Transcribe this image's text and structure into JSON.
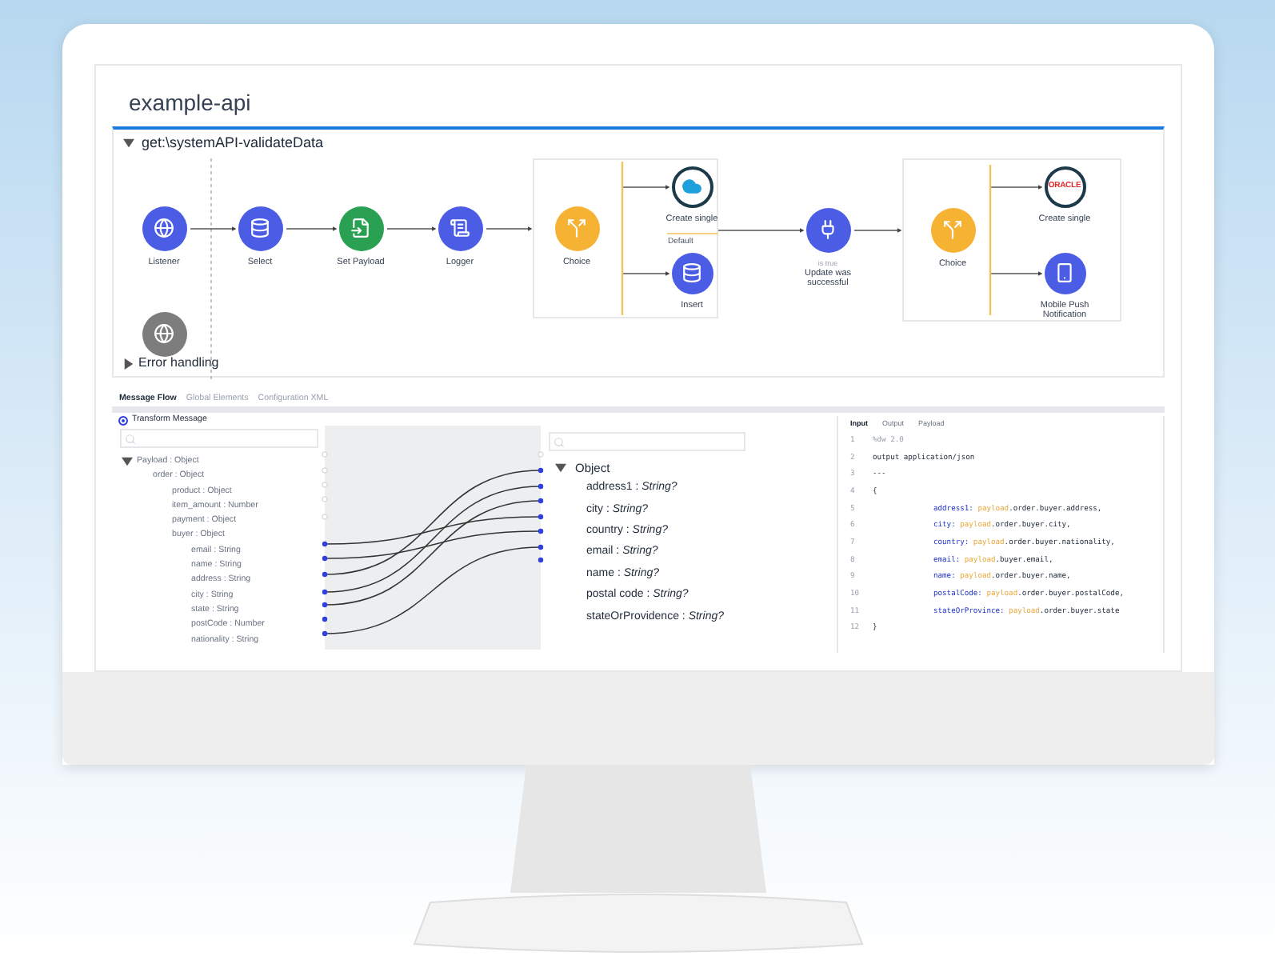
{
  "app_title": "example-api",
  "flow": {
    "title": "get:\\systemAPI-validateData",
    "expanded": true,
    "nodes": [
      {
        "kind": "listener",
        "label": "Listener"
      },
      {
        "kind": "database",
        "label": "Select"
      },
      {
        "kind": "set-payload",
        "label": "Set Payload"
      },
      {
        "kind": "logger",
        "label": "Logger"
      },
      {
        "kind": "choice",
        "label": "Choice"
      },
      {
        "kind": "salesforce",
        "label": "Create single"
      },
      {
        "kind": "database",
        "label": "Insert",
        "branch": "Default"
      },
      {
        "kind": "flow-ref",
        "label": "Update was successful",
        "condition": "is true"
      },
      {
        "kind": "choice",
        "label": "Choice"
      },
      {
        "kind": "oracle",
        "label": "Create single",
        "logo_text": "ORACLE"
      },
      {
        "kind": "push",
        "label": "Mobile Push Notification"
      }
    ],
    "error_handling": {
      "label": "Error handling",
      "expanded": false
    }
  },
  "tabs": [
    {
      "label": "Message Flow",
      "selected": true
    },
    {
      "label": "Global Elements",
      "selected": false
    },
    {
      "label": "Configuration XML",
      "selected": false
    }
  ],
  "transform": {
    "label": "Transform Message",
    "selected": true
  },
  "source_tree": [
    {
      "label": "Payload : Object",
      "expanded": true,
      "children": [
        {
          "label": "order : Object",
          "children": [
            {
              "label": "product : Object"
            },
            {
              "label": "item_amount : Number"
            },
            {
              "label": "payment : Object"
            },
            {
              "label": "buyer : Object",
              "children": [
                {
                  "label": "email : String"
                },
                {
                  "label": "name : String"
                },
                {
                  "label": "address : String"
                },
                {
                  "label": "city : String"
                },
                {
                  "label": "state : String"
                },
                {
                  "label": "postCode : Number"
                },
                {
                  "label": "nationality : String"
                }
              ]
            }
          ]
        }
      ]
    }
  ],
  "target_tree": {
    "label": "Object",
    "expanded": true,
    "fields": [
      "address1 : *String?*",
      "city : *String?*",
      "country : *String?*",
      "email : *String?*",
      "name : *String?*",
      "postal code : *String?*",
      "stateOrProvidence : *String?*"
    ]
  },
  "code_tabs": [
    {
      "label": "Input",
      "selected": true
    },
    {
      "label": "Output",
      "selected": false
    },
    {
      "label": "Payload",
      "selected": false
    }
  ],
  "code_lines": [
    {
      "number": "1",
      "kind": "directive",
      "text": "%dw 2.0"
    },
    {
      "number": "2",
      "kind": "plain",
      "text": "output application/json"
    },
    {
      "number": "3",
      "kind": "plain",
      "text": "---"
    },
    {
      "number": "4",
      "kind": "plain",
      "text": "{"
    },
    {
      "number": "5",
      "kind": "mapping",
      "key": "address1:",
      "source": "payload",
      "path": ".order.buyer.address,"
    },
    {
      "number": "6",
      "kind": "mapping",
      "key": "city:",
      "source": "payload",
      "path": ".order.buyer.city,"
    },
    {
      "number": "7",
      "kind": "mapping",
      "key": "country:",
      "source": "payload",
      "path": ".order.buyer.nationality,"
    },
    {
      "number": "8",
      "kind": "mapping",
      "key": "email:",
      "source": "payload",
      "path": ".buyer.email,"
    },
    {
      "number": "9",
      "kind": "mapping",
      "key": "name:",
      "source": "payload",
      "path": ".order.buyer.name,"
    },
    {
      "number": "10",
      "kind": "mapping",
      "key": "postalCode:",
      "source": "payload",
      "path": ".order.buyer.postalCode,"
    },
    {
      "number": "11",
      "kind": "mapping",
      "key": "stateOrProvince:",
      "source": "payload",
      "path": ".order.buyer.state"
    },
    {
      "number": "12",
      "kind": "plain",
      "text": "}"
    }
  ]
}
